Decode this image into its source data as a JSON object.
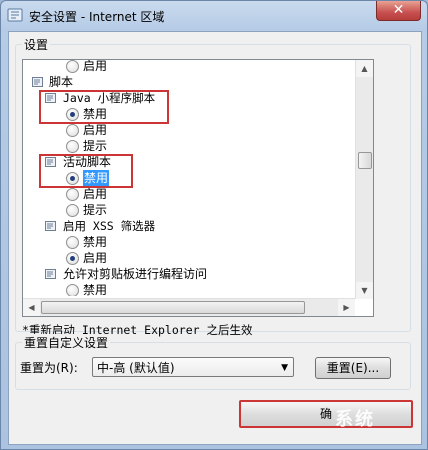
{
  "window": {
    "title": "安全设置 - Internet 区域",
    "close_label": "✕"
  },
  "settings_group": {
    "label": "设置"
  },
  "tree": {
    "r1": "启用",
    "r2": "脚本",
    "r3": "Java 小程序脚本",
    "r4": "禁用",
    "r5": "启用",
    "r6": "提示",
    "r7": "活动脚本",
    "r8": "禁用",
    "r9": "启用",
    "r10": "提示",
    "r11": "启用 XSS 筛选器",
    "r12": "禁用",
    "r13": "启用",
    "r14": "允许对剪贴板进行编程访问",
    "r15": "禁用"
  },
  "note": "*重新启动 Internet Explorer 之后生效",
  "reset_group": {
    "label": "重置自定义设置",
    "reset_to_label": "重置为(R):",
    "reset_to_value": "中-高 (默认值)",
    "reset_button": "重置(E)..."
  },
  "footer": {
    "ok_button": "确"
  },
  "watermark": "系统"
}
